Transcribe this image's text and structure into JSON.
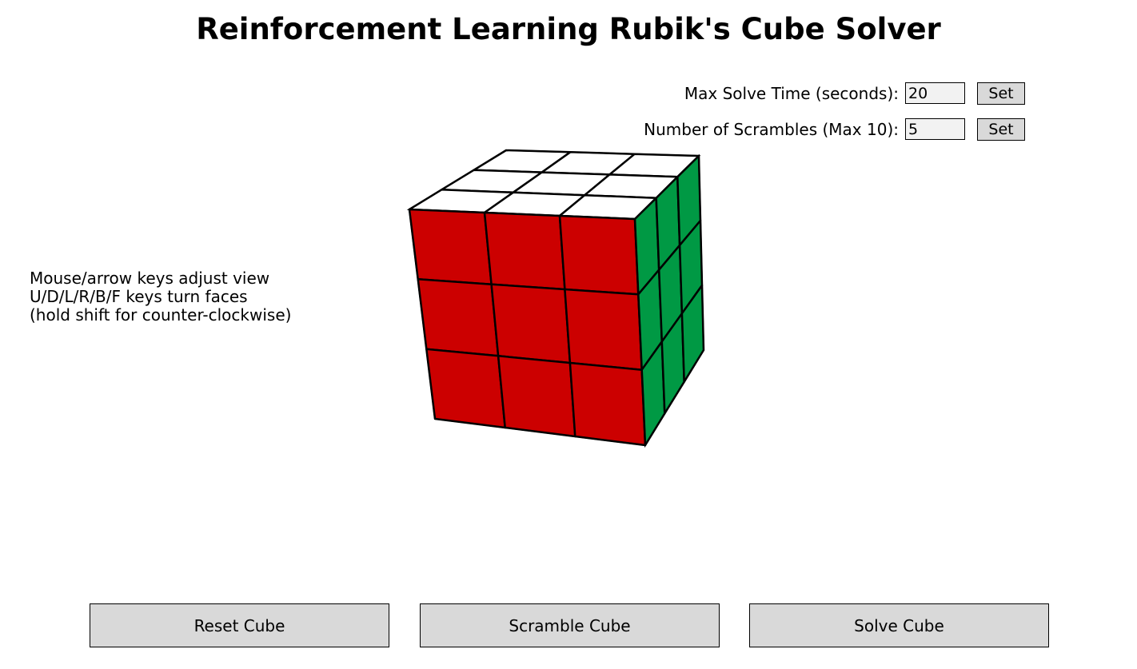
{
  "title": "Reinforcement Learning Rubik's Cube Solver",
  "settings": {
    "max_time": {
      "label": "Max Solve Time (seconds):",
      "value": "20",
      "button_label": "Set"
    },
    "scrambles": {
      "label": "Number of Scrambles (Max 10):",
      "value": "5",
      "button_label": "Set"
    }
  },
  "instructions": [
    "Mouse/arrow keys adjust view",
    "U/D/L/R/B/F keys turn faces",
    "(hold shift for counter-clockwise)"
  ],
  "cube": {
    "colors": {
      "top": "#ffffff",
      "front": "#cc0000",
      "right": "#009944",
      "edge": "#000000"
    }
  },
  "buttons": {
    "reset": "Reset Cube",
    "scramble": "Scramble Cube",
    "solve": "Solve Cube"
  }
}
